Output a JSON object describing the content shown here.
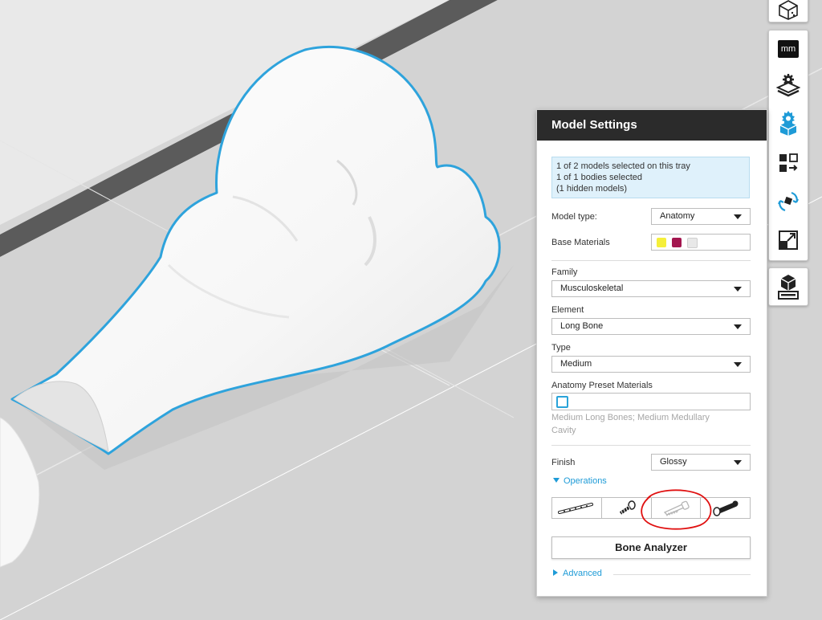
{
  "panel": {
    "title": "Model Settings",
    "selection_info": [
      "1 of 2 models selected on this tray",
      "1 of 1 bodies selected",
      "(1 hidden models)"
    ],
    "model_type": {
      "label": "Model type:",
      "value": "Anatomy"
    },
    "base_materials": {
      "label": "Base Materials",
      "colors": [
        "#f5ef3a",
        "#a3164f",
        "#e8e8e8"
      ]
    },
    "family": {
      "label": "Family",
      "value": "Musculoskeletal"
    },
    "element": {
      "label": "Element",
      "value": "Long Bone"
    },
    "type": {
      "label": "Type",
      "value": "Medium"
    },
    "anatomy_preset": {
      "label": "Anatomy Preset Materials",
      "description": "Medium Long Bones; Medium Medullary Cavity"
    },
    "finish": {
      "label": "Finish",
      "value": "Glossy"
    },
    "operations_label": "Operations",
    "operations": [
      "plate-icon",
      "screw-icon",
      "saw-icon",
      "bone-cut-icon"
    ],
    "bone_analyzer_label": "Bone Analyzer",
    "advanced_label": "Advanced"
  },
  "toolbar": {
    "units_label": "mm",
    "items": [
      "view-cube-icon",
      "units-icon",
      "tray-settings-icon",
      "model-settings-icon",
      "arrange-icon",
      "orient-icon",
      "scale-icon",
      "print-model-icon"
    ]
  },
  "colors": {
    "accent": "#1e9bd7",
    "selection_outline": "#2ea3dc",
    "annotation_circle": "#e01010",
    "header_bg": "#2b2b2b"
  }
}
